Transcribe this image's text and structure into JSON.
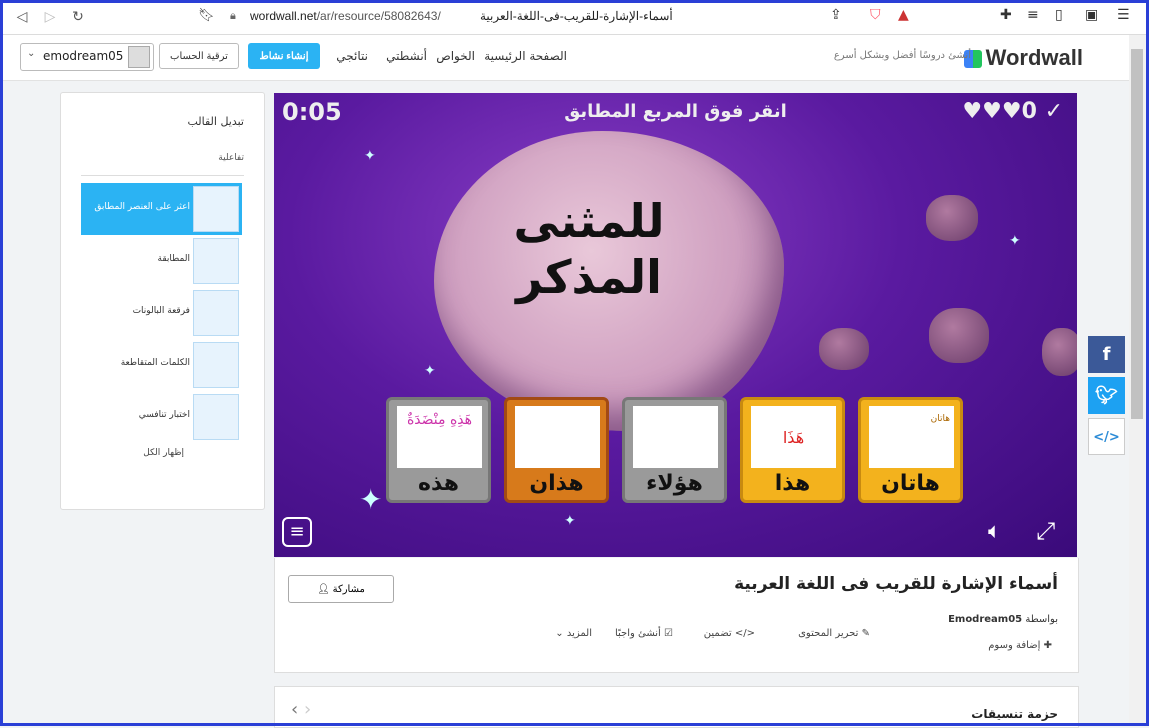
{
  "browser": {
    "url_domain": "wordwall.net",
    "url_path": "/ar/resource/58082643/",
    "url_title": "أسماء-الإشارة-للقريب-فى-اللغة-العربية"
  },
  "header": {
    "logo": "Wordwall",
    "tagline": "أنشئ دروسًا أفضل وبشكل أسرع",
    "nav": [
      "الصفحة الرئيسية",
      "الخواص",
      "أنشطتي",
      "نتائجي"
    ],
    "create_btn": "إنشاء نشاط",
    "upgrade_btn": "ترقية الحساب",
    "username": "emodream05"
  },
  "templates": {
    "title": "تبديل القالب",
    "subtitle": "تفاعلية",
    "items": [
      {
        "label": "اعثر على العنصر المطابق"
      },
      {
        "label": "المطابقة"
      },
      {
        "label": "فرقعة البالونات"
      },
      {
        "label": "الكلمات المتقاطعة"
      },
      {
        "label": "اختبار تنافسي"
      }
    ],
    "show_all": "إظهار الكل"
  },
  "game": {
    "timer": "0:05",
    "prompt": "انقر فوق المربع المطابق",
    "lives": "♥♥♥0",
    "question_line1": "للمثنى",
    "question_line2": "المذكر",
    "cards": [
      {
        "word": "هذه",
        "img_caption": "هَذِهِ مِنْضَدَةٌ"
      },
      {
        "word": "هذان"
      },
      {
        "word": "هؤلاء"
      },
      {
        "word": "هذا",
        "img_caption": "هَذَا"
      },
      {
        "word": "هاتان",
        "img_caption": "هاتان"
      }
    ]
  },
  "info": {
    "title": "أسماء الإشارة للقريب فى اللغة العربية",
    "by_label": "بواسطة",
    "author": "Emodream05",
    "share_btn": "مشاركة",
    "actions": [
      "تحرير المحتوى",
      "تضمين",
      "أنشئ واجبًا",
      "المزيد"
    ],
    "add_tags": "إضافة وسوم"
  },
  "pack": {
    "title": "حزمة تنسيقات"
  }
}
